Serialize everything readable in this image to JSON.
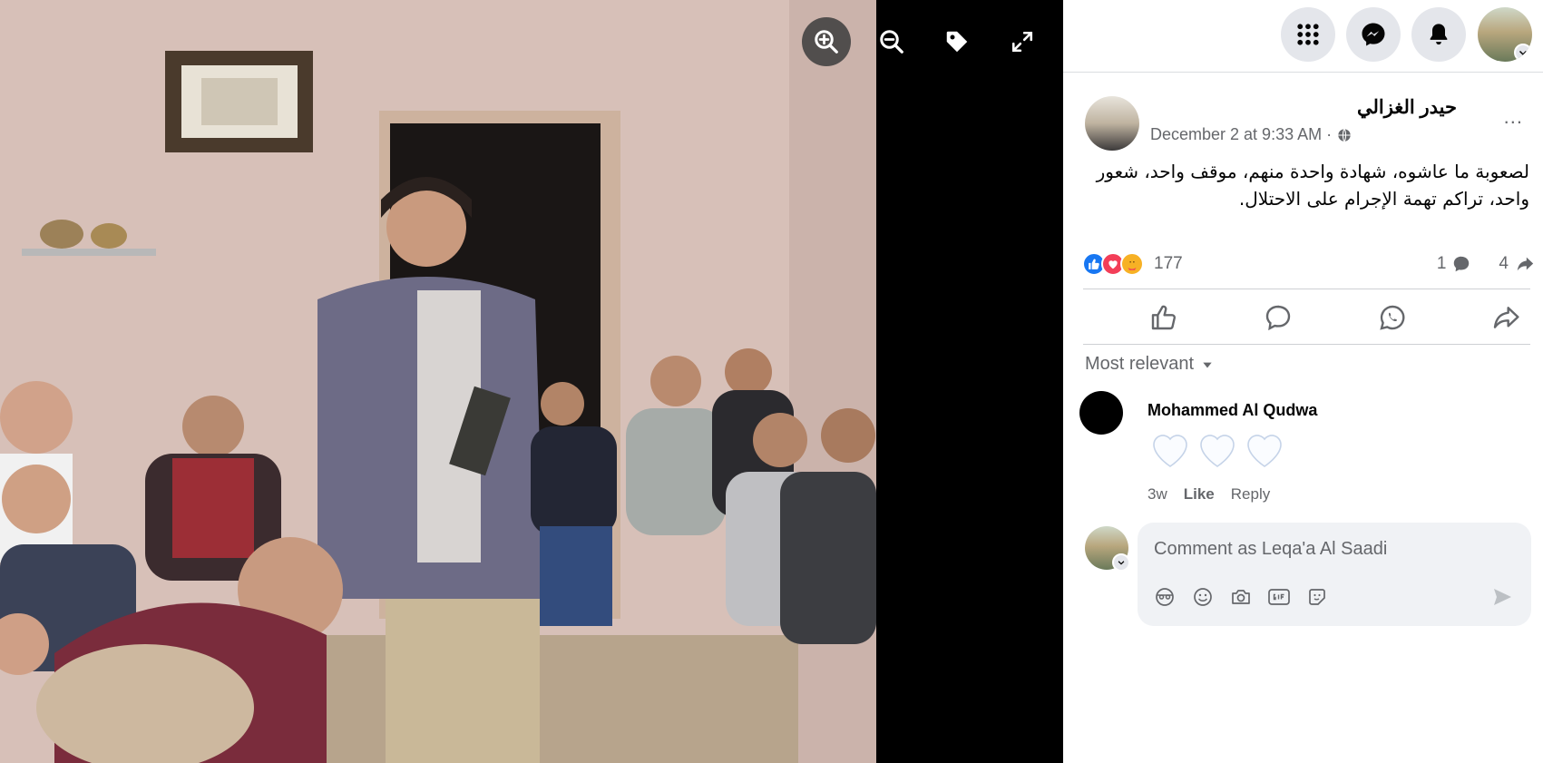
{
  "viewer": {
    "buttons": [
      {
        "name": "zoom-in-icon"
      },
      {
        "name": "zoom-out-icon"
      },
      {
        "name": "tag-icon"
      },
      {
        "name": "fullscreen-icon"
      }
    ]
  },
  "topbar": {
    "icons": [
      "menu-grid-icon",
      "messenger-icon",
      "notifications-bell-icon",
      "account-avatar"
    ]
  },
  "post": {
    "author": "حيدر الغزالي",
    "timestamp": "December 2 at 9:33 AM ·",
    "privacy_icon": "globe-icon",
    "text": "لصعوبة ما عاشوه، شهادة واحدة منهم، موقف واحد، شعور واحد، تراكم تهمة الإجرام على الاحتلال.",
    "more_label": "...",
    "reactions": {
      "types": [
        "like",
        "love",
        "care"
      ],
      "count": "177",
      "comments_count": "1",
      "shares_count": "4"
    },
    "actions": [
      "like-action",
      "comment-action",
      "whatsapp-action",
      "share-action"
    ]
  },
  "comments": {
    "sort_label": "Most relevant",
    "items": [
      {
        "author": "Mohammed Al Qudwa",
        "content": "3 white hearts",
        "time": "3w",
        "like_label": "Like",
        "reply_label": "Reply"
      }
    ],
    "composer": {
      "placeholder": "Comment as Leqa'a Al Saadi",
      "tools": [
        "avatar-sticker-icon",
        "emoji-icon",
        "camera-icon",
        "gif-icon",
        "sticker-icon"
      ],
      "send_icon": "send-icon"
    }
  },
  "colors": {
    "accent": "#1877f2",
    "secondary_text": "#65676b",
    "button_bg": "#e4e6eb",
    "love": "#f33e58",
    "care": "#f7b125"
  }
}
